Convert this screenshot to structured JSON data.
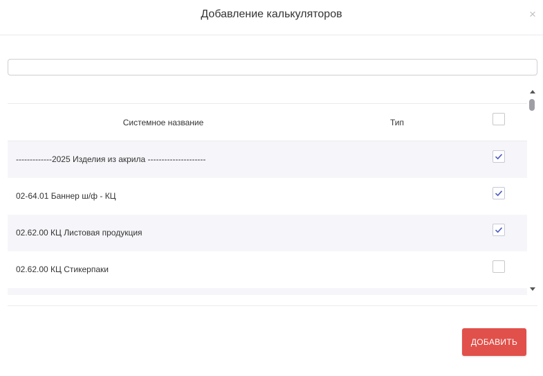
{
  "dialog": {
    "title": "Добавление калькуляторов",
    "close_label": "×"
  },
  "search": {
    "value": "",
    "placeholder": ""
  },
  "table": {
    "columns": {
      "name": "Системное название",
      "type": "Тип"
    },
    "select_all_checked": false,
    "rows": [
      {
        "name": "-------------2025 Изделия из акрила ---------------------",
        "type": "",
        "checked": true
      },
      {
        "name": "02-64.01 Баннер ш/ф - КЦ",
        "type": "",
        "checked": true
      },
      {
        "name": "02.62.00 КЦ Листовая продукция",
        "type": "",
        "checked": true
      },
      {
        "name": "02.62.00 КЦ Стикерпаки",
        "type": "",
        "checked": false
      },
      {
        "name": "",
        "type": "",
        "checked": false
      }
    ]
  },
  "footer": {
    "add_label": "ДОБАВИТЬ"
  },
  "colors": {
    "accent": "#e1504a",
    "check": "#4a5bc4",
    "row_alt": "#f6f6fa"
  },
  "icons": {
    "close": "close-icon",
    "check": "checkmark-icon",
    "scroll_up": "arrow-up-icon",
    "scroll_down": "arrow-down-icon"
  }
}
